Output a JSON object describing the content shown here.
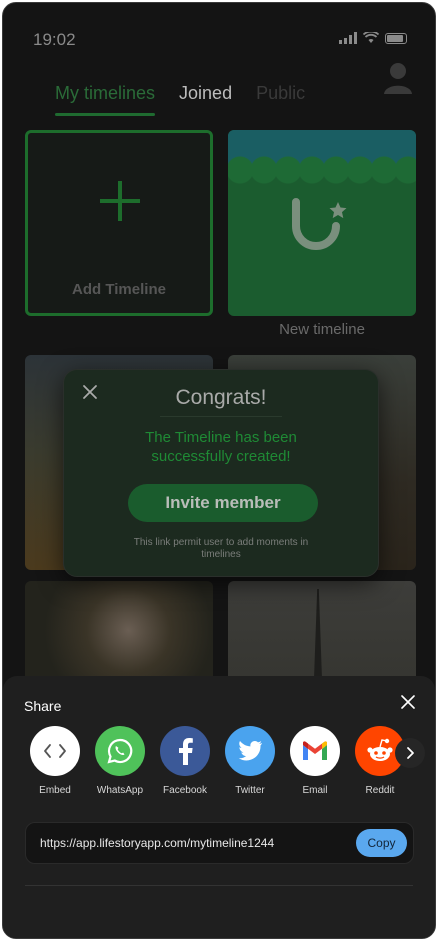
{
  "status_bar": {
    "time": "19:02"
  },
  "tabs": [
    {
      "label": "My timelines"
    },
    {
      "label": "Joined"
    },
    {
      "label": "Public"
    }
  ],
  "grid": {
    "add_label": "Add Timeline",
    "new_label": "New timeline"
  },
  "modal": {
    "title": "Congrats!",
    "message": "The Timeline has been successfully created!",
    "invite_label": "Invite member",
    "note": "This link permit user to add moments in timelines"
  },
  "share": {
    "title": "Share",
    "items": [
      {
        "label": "Embed",
        "icon": "embed-icon",
        "color": "#ffffff"
      },
      {
        "label": "WhatsApp",
        "icon": "whatsapp-icon",
        "color": "#4fc25a"
      },
      {
        "label": "Facebook",
        "icon": "facebook-icon",
        "color": "#3b5998"
      },
      {
        "label": "Twitter",
        "icon": "twitter-icon",
        "color": "#4aa3ee"
      },
      {
        "label": "Email",
        "icon": "gmail-icon",
        "color": "#ffffff"
      },
      {
        "label": "Reddit",
        "icon": "reddit-icon",
        "color": "#ff4500"
      }
    ],
    "link": "https://app.lifestoryapp.com/mytimeline1244",
    "copy_label": "Copy"
  },
  "colors": {
    "accent_green": "#1f8a35",
    "copy_blue": "#5aa8ef"
  }
}
